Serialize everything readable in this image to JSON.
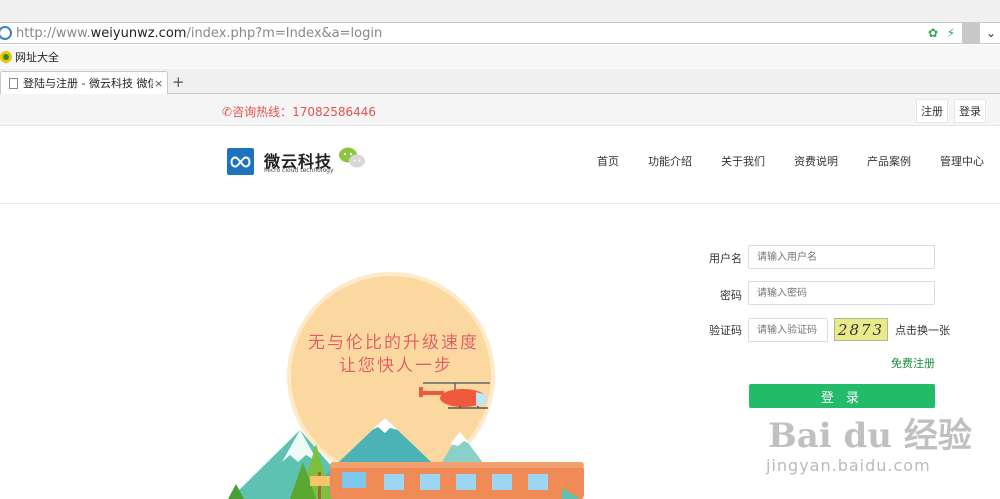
{
  "browser": {
    "url_prefix": "http://www.",
    "url_host": "weiyunwz.com",
    "url_path": "/index.php?m=Index&a=login",
    "favorites_label": "网址大全",
    "tab_title": "登陆与注册 - 微云科技 微信营销",
    "tab_close": "×",
    "new_tab": "+"
  },
  "topbar": {
    "hotline_label": "咨询热线：",
    "hotline_number": "17082586446",
    "register": "注册",
    "login": "登录"
  },
  "header": {
    "logo_name": "微云科技",
    "logo_sub": "Micro cloud technology",
    "nav": [
      "首页",
      "功能介绍",
      "关于我们",
      "资费说明",
      "产品案例",
      "管理中心"
    ]
  },
  "hero": {
    "slogan_line1": "无与伦比的升级速度",
    "slogan_line2": "让您快人一步"
  },
  "form": {
    "username_label": "用户名",
    "username_placeholder": "请输入用户名",
    "password_label": "密码",
    "password_placeholder": "请输入密码",
    "captcha_label": "验证码",
    "captcha_placeholder": "请输入验证码",
    "captcha_code": "2873",
    "refresh_text": "点击换一张",
    "register_link": "免费注册",
    "login_button": "登 录"
  },
  "watermark": {
    "line1": "Bai du 经验",
    "line2": "jingyan.baidu.com"
  },
  "colors": {
    "accent_green": "#22bb6a",
    "hotline_red": "#e0524f",
    "logo_blue": "#1e73be",
    "sun": "#fcd8a1"
  }
}
